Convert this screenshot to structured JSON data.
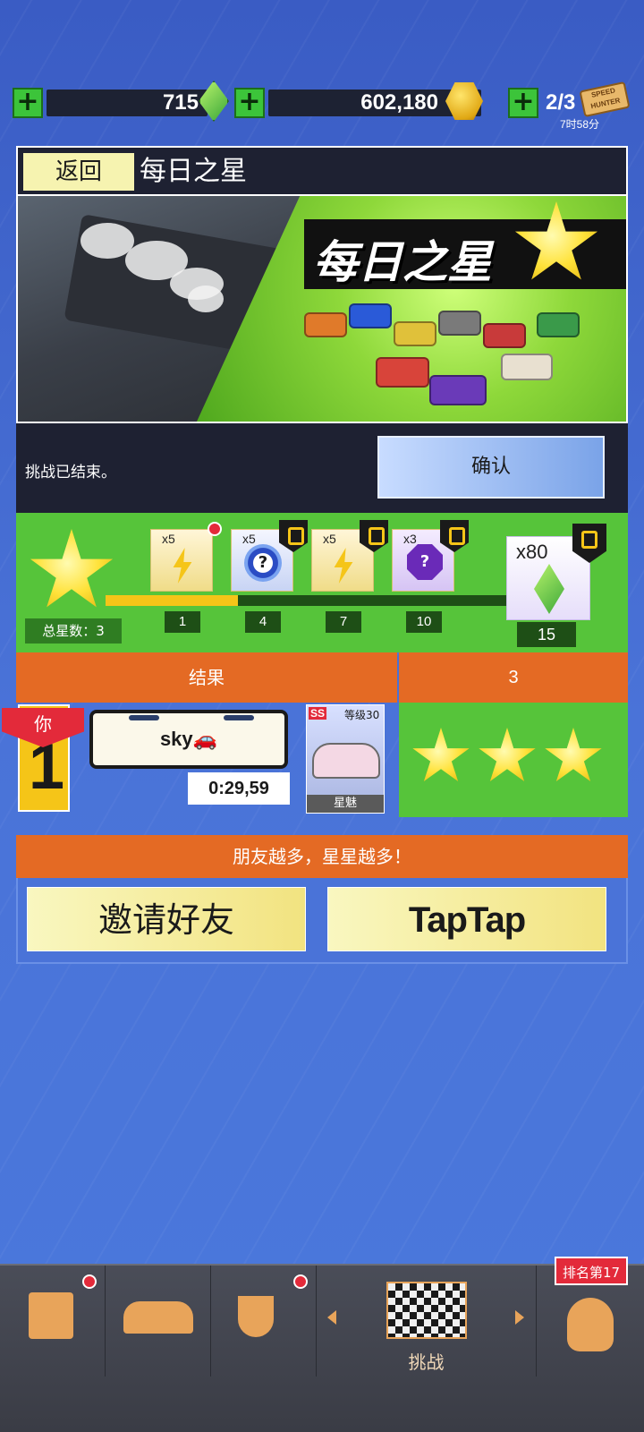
{
  "currencies": {
    "gems": "715",
    "coins": "602,180",
    "tickets": "2/3",
    "ticket_timer": "7时58分",
    "ticket_label": "SPEED HUNTER"
  },
  "header": {
    "back_label": "返回",
    "title": "每日之星"
  },
  "banner": {
    "title": "每日之星"
  },
  "status": {
    "message": "挑战已结束。",
    "confirm_label": "确认"
  },
  "progress": {
    "total_label": "总星数：3",
    "total_stars": 3,
    "fill_fraction": 0.33,
    "rewards": [
      {
        "qty": "x5",
        "type": "lightning",
        "milestone": "1",
        "locked": false
      },
      {
        "qty": "x5",
        "type": "mystery-coin",
        "milestone": "4",
        "locked": true
      },
      {
        "qty": "x5",
        "type": "lightning",
        "milestone": "7",
        "locked": true
      },
      {
        "qty": "x3",
        "type": "mystery-gem",
        "milestone": "10",
        "locked": true
      }
    ],
    "final_reward": {
      "qty": "x80",
      "type": "gem",
      "milestone": "15",
      "locked": true
    }
  },
  "results": {
    "header_label": "结果",
    "header_value": "3",
    "rank": "1",
    "you_label": "你",
    "player_name": "sky🚗",
    "time": "0:29,59",
    "car_class": "SS",
    "car_level": "等级30",
    "car_name": "星魅",
    "stars_earned": 3
  },
  "friends": {
    "header": "朋友越多，星星越多！",
    "invite_label": "邀请好友",
    "taptap_label": "TapTap"
  },
  "nav": {
    "challenge_label": "挑战",
    "rank_badge": "排名第17"
  },
  "colors": {
    "accent_orange": "#e46a24",
    "green": "#56c43a",
    "star_yellow": "#f5c518",
    "dark_panel": "#1e2132"
  }
}
